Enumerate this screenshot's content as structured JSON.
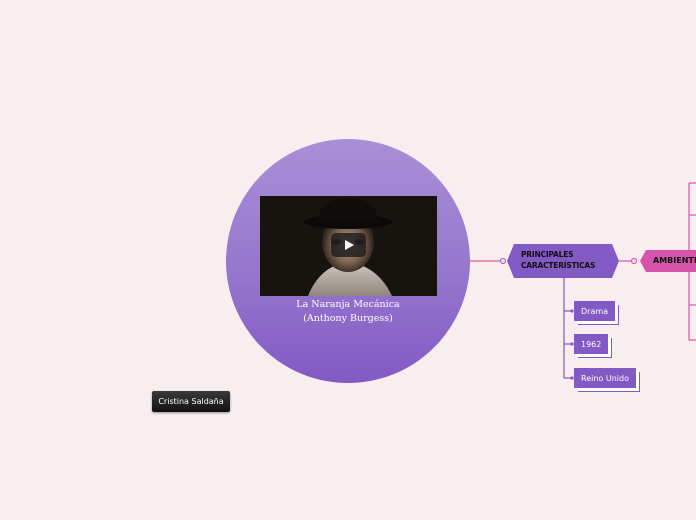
{
  "central_topic": {
    "title_line1": "La Naranja Mecánica",
    "title_line2": "(Anthony Burgess)",
    "video": {
      "play_icon": "play-icon"
    }
  },
  "author_label": "Cristina Saldaña",
  "main_branch": {
    "label_line1": "PRINCIPALES",
    "label_line2": "CARACTERÍSTICAS",
    "children": [
      {
        "label": "Drama"
      },
      {
        "label": "1962"
      },
      {
        "label": "Reino Unido"
      }
    ]
  },
  "secondary_branch": {
    "label": "AMBIENTE"
  },
  "colors": {
    "background": "#f8eef0",
    "purple": "#8359c4",
    "pink": "#d655aa",
    "connector": "#e25a90"
  }
}
